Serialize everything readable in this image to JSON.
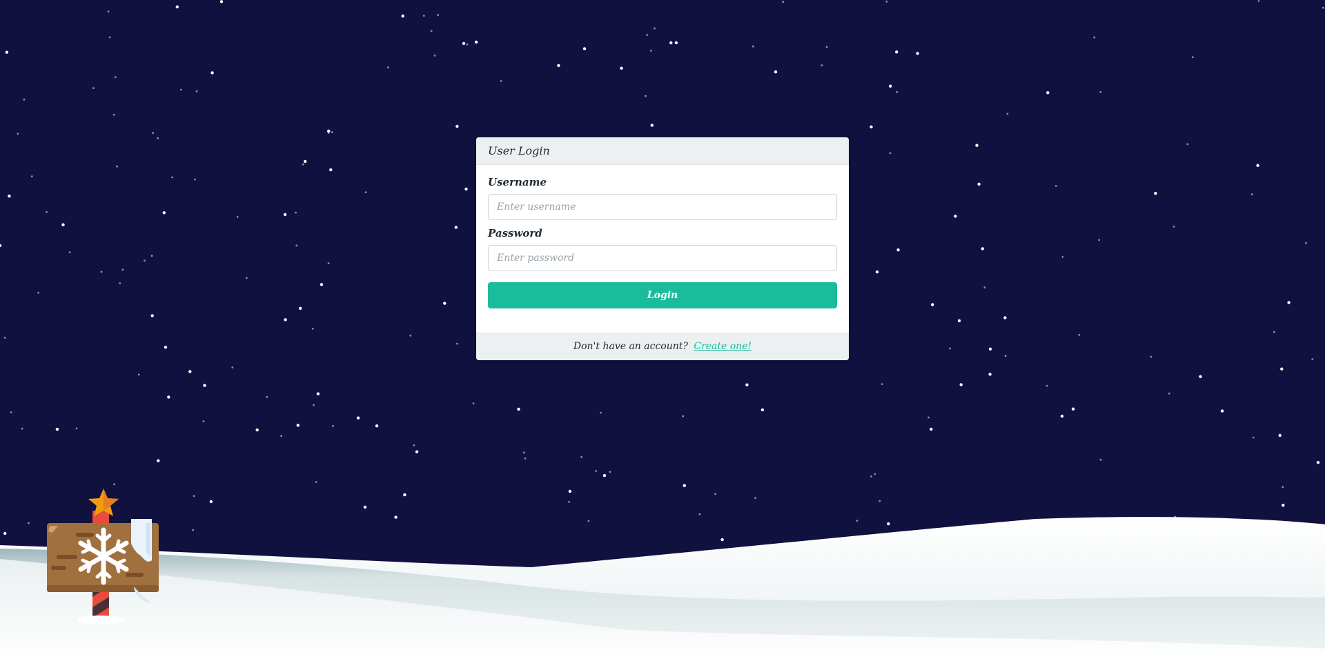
{
  "login_card": {
    "title": "User Login",
    "username_label": "Username",
    "username_placeholder": "Enter username",
    "username_value": "",
    "password_label": "Password",
    "password_placeholder": "Enter password",
    "password_value": "",
    "login_label": "Login",
    "footer_text": "Don't have an account?",
    "footer_link": "Create one!"
  },
  "scene": {
    "sky_color": "#10113f",
    "snow_color": "#f4f7f7",
    "snow_shadow_color": "#c9d6da",
    "accent_color": "#1abc9c",
    "signpost_icon": "snowflake-sign-icon"
  }
}
